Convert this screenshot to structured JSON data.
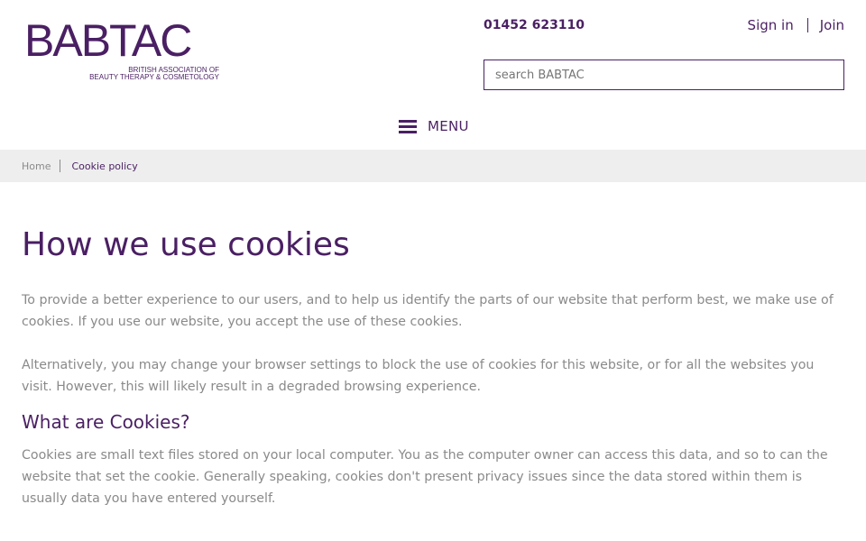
{
  "logo": {
    "wordmark": "BABTAC",
    "line1": "BRITISH ASSOCIATION OF",
    "line2": "BEAUTY THERAPY & COSMETOLOGY"
  },
  "header": {
    "phone": "01452 623110",
    "sign_in": "Sign in",
    "join": "Join",
    "search_placeholder": "search BABTAC",
    "menu_label": "MENU"
  },
  "breadcrumb": {
    "items": [
      "Home",
      "Cookie policy"
    ]
  },
  "main": {
    "title": "How we use cookies",
    "paragraphs": [
      "To provide a better experience to our users, and to help us identify the parts of our website that perform best, we make use of cookies. If you use our website, you accept the use of these cookies.",
      "Alternatively, you may change your browser settings to block the use of cookies for this website, or for all the websites you visit. However, this will likely result in a degraded browsing experience."
    ],
    "section_heading": "What are Cookies?",
    "section_paragraph": "Cookies are small text files stored on your local computer. You as the computer owner can access this data, and so to can the website that set the cookie. Generally speaking, cookies don't present privacy issues since the data stored within them is usually data you have entered yourself."
  },
  "icons": {
    "menu": "hamburger-icon"
  },
  "colors": {
    "brand": "#4a1f63",
    "body_text": "#8a8a8a",
    "breadcrumb_bg": "#eeeeee"
  }
}
